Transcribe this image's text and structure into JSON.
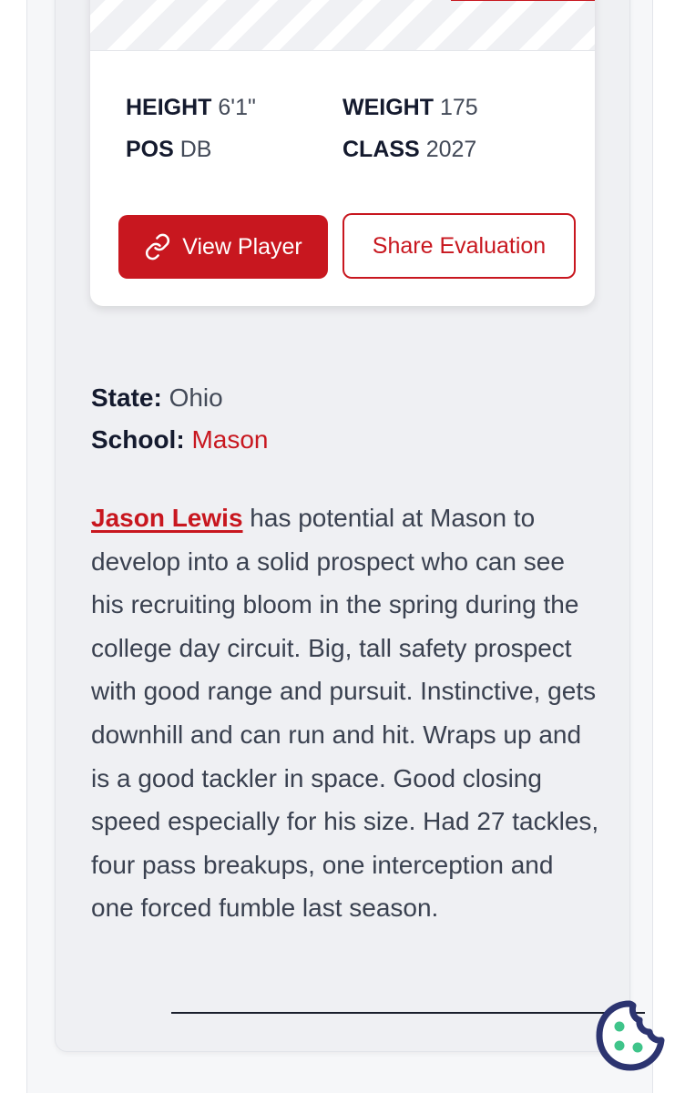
{
  "player": {
    "name": "Jason Lewis",
    "stats": {
      "height_label": "HEIGHT",
      "height_value": "6'1\"",
      "weight_label": "WEIGHT",
      "weight_value": "175",
      "pos_label": "POS",
      "pos_value": "DB",
      "class_label": "CLASS",
      "class_value": "2027"
    },
    "buttons": {
      "view_player": "View Player",
      "share_evaluation": "Share Evaluation"
    }
  },
  "details": {
    "state_label": "State:",
    "state_value": "Ohio",
    "school_label": "School:",
    "school_value": "Mason"
  },
  "evaluation": {
    "name_link": "Jason Lewis",
    "text": " has potential at Mason to develop into a solid prospect who can see his recruiting bloom in the spring during the college day circuit. Big, tall safety prospect with good range and pursuit. Instinctive, gets downhill and can run and hit. Wraps up and is a good tackler in space. Good closing speed especially for his size. Had 27 tackles, four pass breakups, one interception and one forced fumble last season."
  },
  "colors": {
    "accent": "#c8171f",
    "heading": "#141a2e",
    "body_text": "#3a4150",
    "cookie": "#2c3470",
    "cookie_dots": "#3fc48a"
  },
  "icons": {
    "view_player": "link-icon",
    "cookie": "cookie-icon"
  }
}
